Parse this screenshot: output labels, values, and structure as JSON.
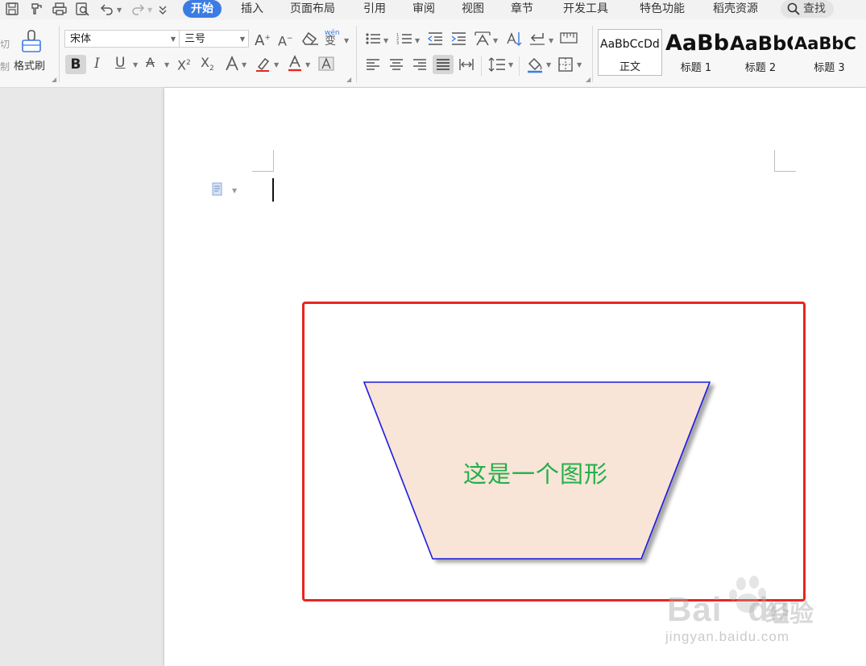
{
  "menubar": {
    "tabs": [
      {
        "label": "开始",
        "active": true
      },
      {
        "label": "插入"
      },
      {
        "label": "页面布局"
      },
      {
        "label": "引用"
      },
      {
        "label": "审阅"
      },
      {
        "label": "视图"
      },
      {
        "label": "章节"
      },
      {
        "label": "开发工具"
      },
      {
        "label": "特色功能"
      },
      {
        "label": "稻壳资源"
      }
    ],
    "search_label": "查找",
    "accent_color": "#3b7ce4"
  },
  "ribbon": {
    "cut_label": "切",
    "copy_label": "制",
    "format_painter_label": "格式刷",
    "font_name": "宋体",
    "font_size": "三号",
    "phonetic_label": "wén",
    "phonetic_glyph": "变",
    "styles": [
      {
        "sample": "AaBbCcDd",
        "name": "正文",
        "selected": true
      },
      {
        "sample": "AaBb",
        "name": "标题 1"
      },
      {
        "sample": "AaBbC",
        "name": "标题 2"
      },
      {
        "sample": "AaBbC",
        "name": "标题 3"
      }
    ]
  },
  "document": {
    "shape_text": "这是一个图形",
    "shape_text_color": "#22b04a",
    "shape_fill": "#f9e4d8",
    "shape_stroke": "#1a1adf",
    "frame_color": "#e8261f"
  },
  "watermark": {
    "brand": "Bai",
    "brand2": "du",
    "product": "经验",
    "url": "jingyan.baidu.com"
  }
}
